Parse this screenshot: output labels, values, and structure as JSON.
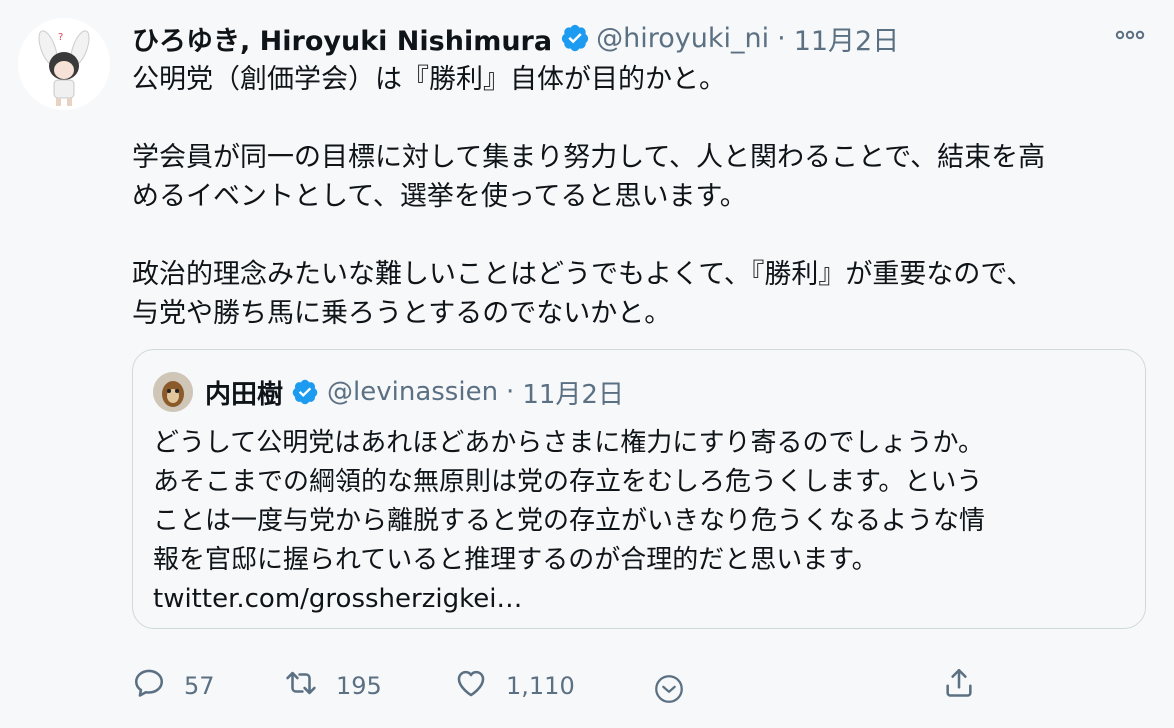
{
  "tweet": {
    "display_name": "ひろゆき, Hiroyuki Nishimura",
    "handle": "@hiroyuki_ni",
    "separator": "·",
    "date": "11月2日",
    "paragraphs": [
      [
        "公明党（創価学会）は『勝利』自体が目的かと。"
      ],
      [
        "学会員が同一の目標に対して集まり努力して、人と関わることで、結束を高",
        "めるイベントとして、選挙を使ってると思います。"
      ],
      [
        "政治的理念みたいな難しいことはどうでもよくて、『勝利』が重要なので、",
        "与党や勝ち馬に乗ろうとするのでないかと。"
      ]
    ]
  },
  "quote": {
    "display_name": "内田樹",
    "handle": "@levinassien",
    "separator": "·",
    "date": "11月2日",
    "lines": [
      "どうして公明党はあれほどあからさまに権力にすり寄るのでしょうか。",
      "あそこまでの綱領的な無原則は党の存立をむしろ危うくします。という",
      "ことは一度与党から離脱すると党の存立がいきなり危うくなるような情",
      "報を官邸に握られていると推理するのが合理的だと思います。",
      "twitter.com/grossherzigkei…"
    ]
  },
  "actions": {
    "reply_count": "57",
    "retweet_count": "195",
    "like_count": "1,110"
  },
  "icons": {
    "verified": "verified-badge-icon",
    "more": "more-options-icon",
    "reply": "reply-icon",
    "retweet": "retweet-icon",
    "like": "like-icon",
    "caret": "caret-down-icon",
    "share": "share-icon"
  },
  "colors": {
    "verified_blue": "#1d9bf0",
    "secondary_text": "#5b7083",
    "border": "#cfd9de"
  }
}
